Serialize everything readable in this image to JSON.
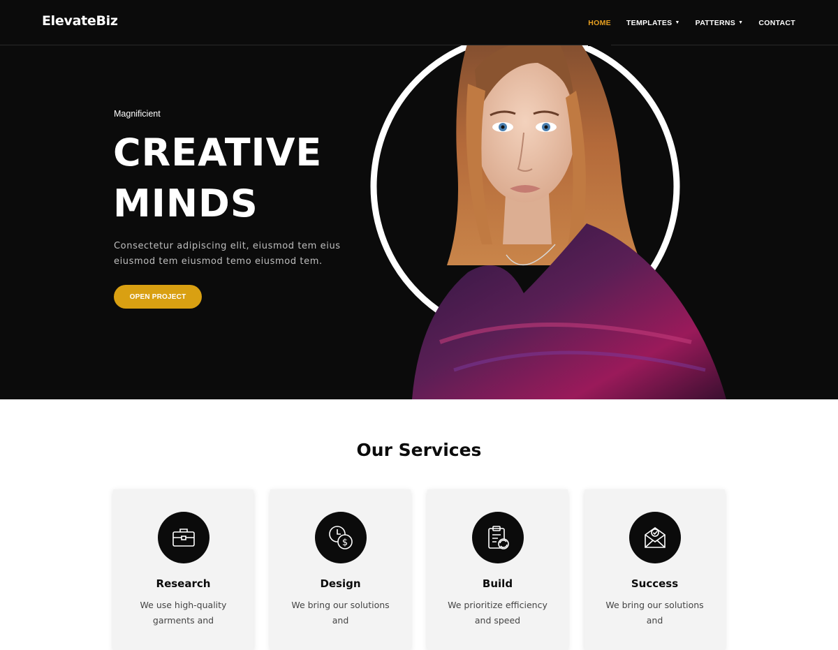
{
  "header": {
    "logo": "ElevateBiz",
    "nav": [
      {
        "label": "HOME",
        "active": true
      },
      {
        "label": "TEMPLATES",
        "has_dropdown": true
      },
      {
        "label": "PATTERNS",
        "has_dropdown": true
      },
      {
        "label": "CONTACT"
      }
    ],
    "dropdown_caret": "⌄"
  },
  "hero": {
    "eyebrow": "Magnificient",
    "title_line1": "CREATIVE",
    "title_line2": "MINDS",
    "description": "Consectetur adipiscing elit, eiusmod tem eius eiusmod tem eiusmod temo eiusmod tem.",
    "button_label": "OPEN PROJECT"
  },
  "services": {
    "title": "Our Services",
    "cards": [
      {
        "icon": "briefcase-icon",
        "title": "Research",
        "text": "We use high-quality garments and"
      },
      {
        "icon": "clock-dollar-icon",
        "title": "Design",
        "text": "We bring our solutions and"
      },
      {
        "icon": "clipboard-refresh-icon",
        "title": "Build",
        "text": "We prioritize efficiency and speed"
      },
      {
        "icon": "mail-check-icon",
        "title": "Success",
        "text": "We bring our solutions and"
      }
    ]
  },
  "colors": {
    "dark": "#0b0b0b",
    "accent_nav": "#e8a020",
    "button": "#d9a012",
    "card_bg": "#f3f3f3"
  }
}
